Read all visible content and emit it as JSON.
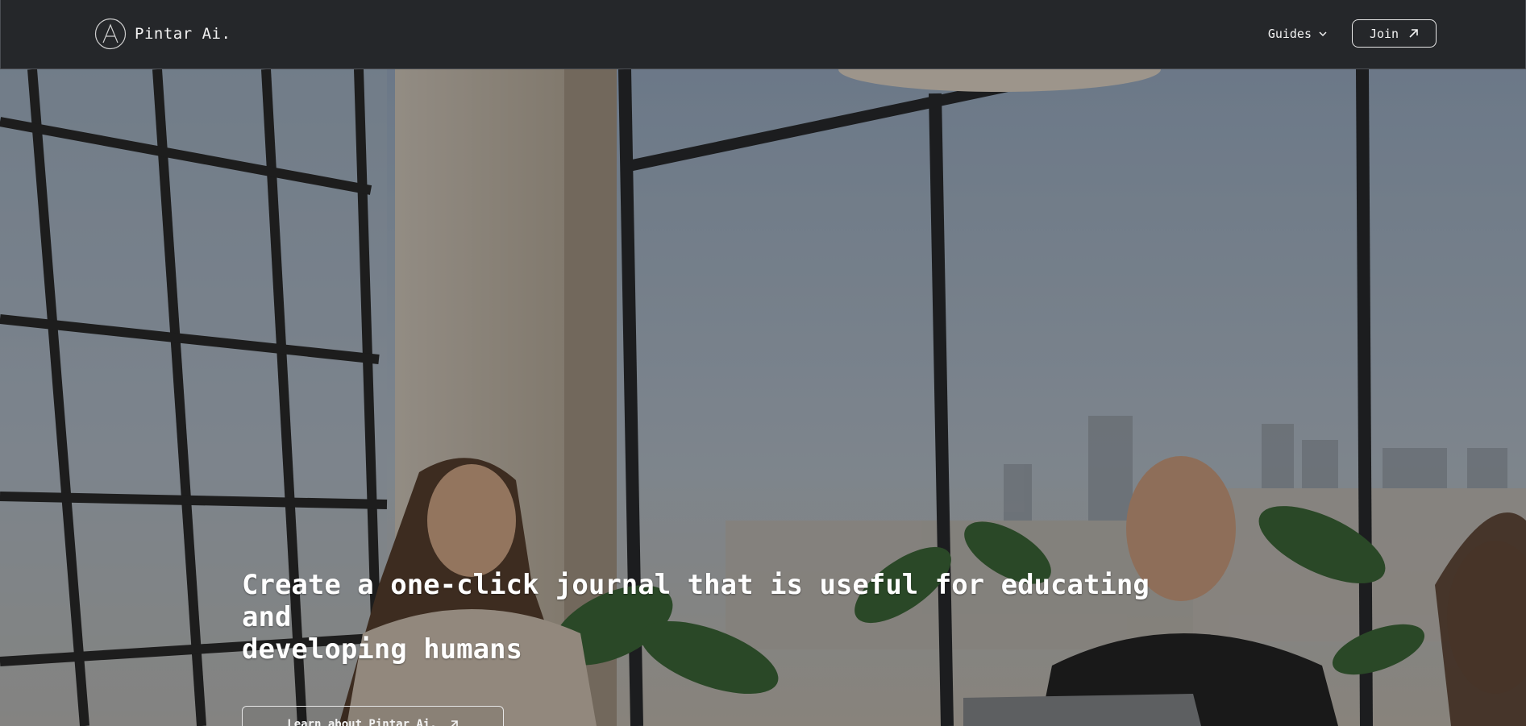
{
  "navbar": {
    "brand_name": "Pintar Ai.",
    "guides_label": "Guides",
    "join_label": "Join"
  },
  "hero": {
    "title_line1": "Create a one-click journal that is useful for educating and",
    "title_line2": "developing humans",
    "cta_label": "Learn about Pintar Ai."
  },
  "icons": {
    "brand": "circle-a-logo-icon",
    "guides": "chevron-down-icon",
    "join": "arrow-up-right-icon",
    "cta": "arrow-up-right-icon"
  },
  "colors": {
    "navbar_bg": "#25272a",
    "text": "#f2f2f2",
    "button_border": "#e8e8e8"
  }
}
